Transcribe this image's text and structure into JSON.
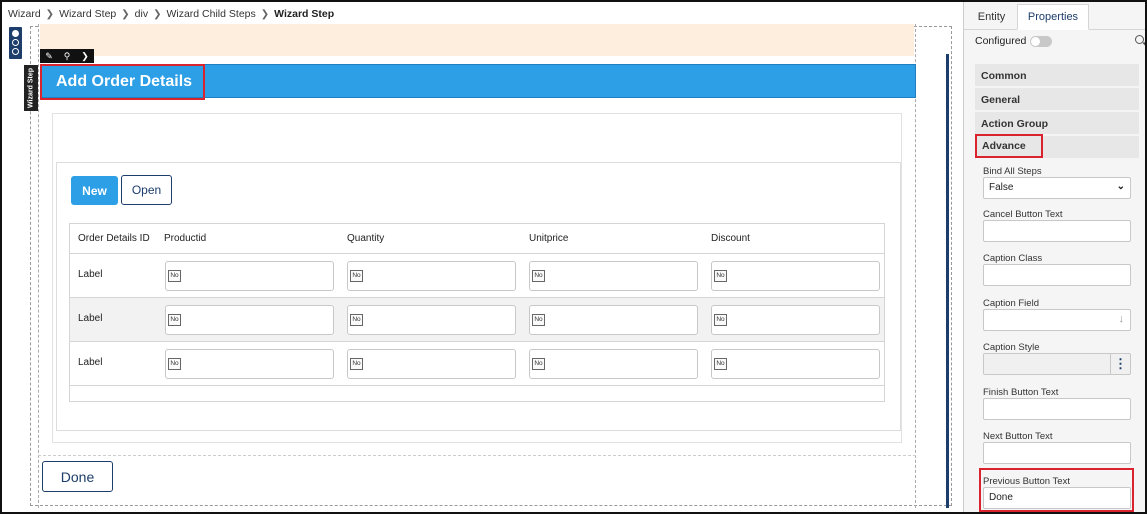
{
  "breadcrumb": {
    "items": [
      "Wizard",
      "Wizard Step",
      "div",
      "Wizard Child Steps"
    ],
    "current": "Wizard Step"
  },
  "canvas": {
    "side_label": "Wizard Step",
    "step_title": "Add Order Details",
    "buttons": {
      "new": "New",
      "open": "Open",
      "done": "Done"
    },
    "grid": {
      "columns": [
        "Order Details ID",
        "Productid",
        "Quantity",
        "Unitprice",
        "Discount"
      ],
      "rows": [
        {
          "label": "Label",
          "cells": [
            "No",
            "No",
            "No",
            "No"
          ]
        },
        {
          "label": "Label",
          "cells": [
            "No",
            "No",
            "No",
            "No"
          ]
        },
        {
          "label": "Label",
          "cells": [
            "No",
            "No",
            "No",
            "No"
          ]
        }
      ]
    },
    "colors": {
      "accent": "#2d9fe6",
      "navy": "#1d3d6b",
      "highlight": "#d9232e",
      "peach": "#fdeedd"
    }
  },
  "properties": {
    "tabs": {
      "entity": "Entity",
      "properties": "Properties"
    },
    "configured_label": "Configured",
    "sections": {
      "common": "Common",
      "general": "General",
      "action_group": "Action Group",
      "advance": "Advance"
    },
    "fields": {
      "bind_all_steps": {
        "label": "Bind All Steps",
        "value": "False"
      },
      "cancel_button_text": {
        "label": "Cancel Button Text",
        "value": ""
      },
      "caption_class": {
        "label": "Caption Class",
        "value": ""
      },
      "caption_field": {
        "label": "Caption Field",
        "value": ""
      },
      "caption_style": {
        "label": "Caption Style",
        "value": ""
      },
      "finish_button_text": {
        "label": "Finish Button Text",
        "value": ""
      },
      "next_button_text": {
        "label": "Next Button Text",
        "value": ""
      },
      "previous_button_text": {
        "label": "Previous Button Text",
        "value": "Done"
      }
    }
  }
}
